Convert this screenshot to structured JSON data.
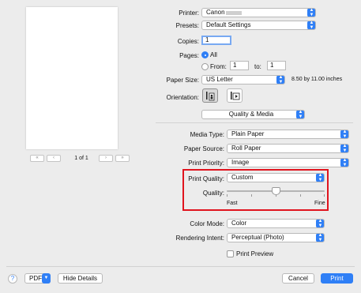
{
  "preview": {
    "page_indicator": "1 of 1",
    "first_glyph": "«",
    "prev_glyph": "‹",
    "next_glyph": "›",
    "last_glyph": "»"
  },
  "printer": {
    "label": "Printer:",
    "value": "Canon"
  },
  "presets": {
    "label": "Presets:",
    "value": "Default Settings"
  },
  "copies": {
    "label": "Copies:",
    "value": "1"
  },
  "pages": {
    "label": "Pages:",
    "all_label": "All",
    "from_label": "From:",
    "from_value": "1",
    "to_label": "to:",
    "to_value": "1",
    "selected": "All"
  },
  "paper_size": {
    "label": "Paper Size:",
    "value": "US Letter",
    "dimensions": "8.50 by 11.00 inches"
  },
  "orientation": {
    "label": "Orientation:",
    "selected": "portrait"
  },
  "section": {
    "value": "Quality & Media"
  },
  "media_type": {
    "label": "Media Type:",
    "value": "Plain Paper"
  },
  "paper_source": {
    "label": "Paper Source:",
    "value": "Roll Paper"
  },
  "print_priority": {
    "label": "Print Priority:",
    "value": "Image"
  },
  "print_quality": {
    "label": "Print Quality:",
    "value": "Custom",
    "highlight_color": "#e0141e"
  },
  "quality": {
    "label": "Quality:",
    "min_label": "Fast",
    "max_label": "Fine",
    "level": 0.5
  },
  "color_mode": {
    "label": "Color Mode:",
    "value": "Color"
  },
  "rendering_intent": {
    "label": "Rendering Intent:",
    "value": "Perceptual (Photo)"
  },
  "print_preview": {
    "label": "Print Preview",
    "checked": false
  },
  "footer": {
    "help_glyph": "?",
    "pdf_label": "PDF",
    "hide_details_label": "Hide Details",
    "cancel_label": "Cancel",
    "print_label": "Print"
  },
  "colors": {
    "accent": "#2f7ff6"
  }
}
